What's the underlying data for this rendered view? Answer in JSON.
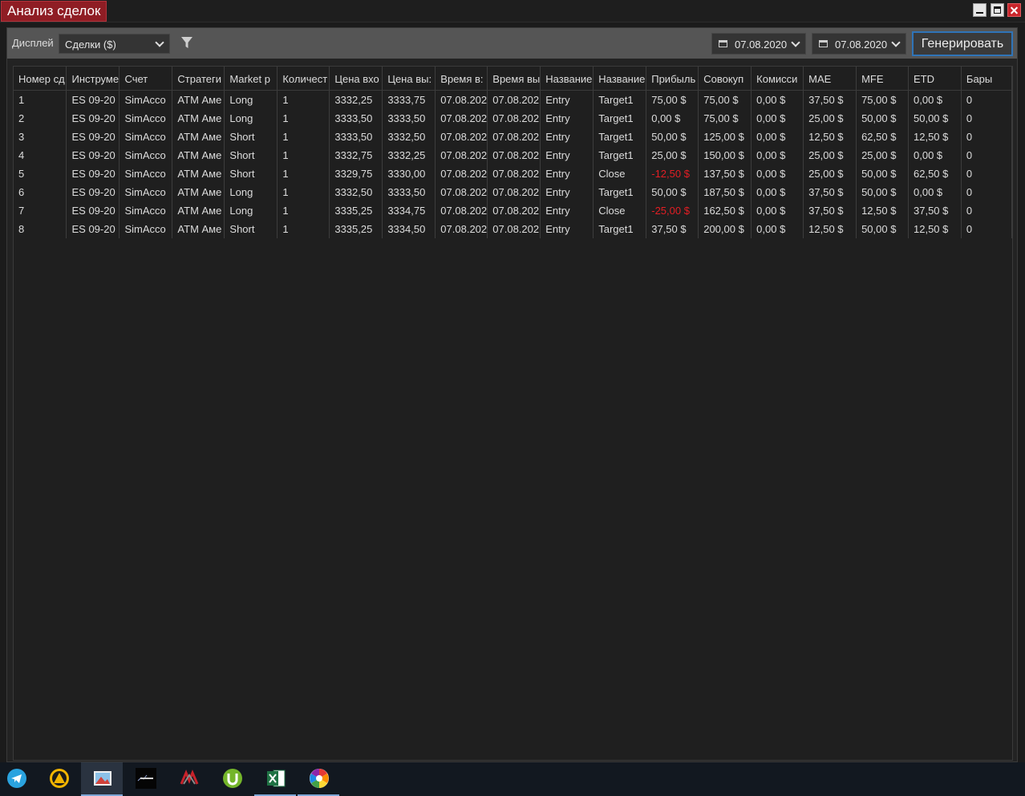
{
  "window": {
    "title": "Анализ сделок"
  },
  "toolbar": {
    "display_label": "Дисплей",
    "display_value": "Сделки ($)",
    "date_from": "07.08.2020",
    "date_to": "07.08.2020",
    "generate_label": "Генерировать"
  },
  "table": {
    "columns": [
      "Номер сд",
      "Инструме",
      "Счет",
      "Стратеги",
      "Market p",
      "Количест",
      "Цена вхо",
      "Цена вы:",
      "Время в:",
      "Время вы",
      "Название",
      "Название",
      "Прибыль",
      "Совокуп",
      "Комисси",
      "MAE",
      "MFE",
      "ETD",
      "Бары"
    ],
    "rows": [
      [
        "1",
        "ES 09-20",
        "SimAcco",
        "ATM Аме",
        "Long",
        "1",
        "3332,25",
        "3333,75",
        "07.08.202",
        "07.08.202",
        "Entry",
        "Target1",
        "75,00 $",
        "75,00 $",
        "0,00 $",
        "37,50 $",
        "75,00 $",
        "0,00 $",
        "0"
      ],
      [
        "2",
        "ES 09-20",
        "SimAcco",
        "ATM Аме",
        "Long",
        "1",
        "3333,50",
        "3333,50",
        "07.08.202",
        "07.08.202",
        "Entry",
        "Target1",
        "0,00 $",
        "75,00 $",
        "0,00 $",
        "25,00 $",
        "50,00 $",
        "50,00 $",
        "0"
      ],
      [
        "3",
        "ES 09-20",
        "SimAcco",
        "ATM Аме",
        "Short",
        "1",
        "3333,50",
        "3332,50",
        "07.08.202",
        "07.08.202",
        "Entry",
        "Target1",
        "50,00 $",
        "125,00 $",
        "0,00 $",
        "12,50 $",
        "62,50 $",
        "12,50 $",
        "0"
      ],
      [
        "4",
        "ES 09-20",
        "SimAcco",
        "ATM Аме",
        "Short",
        "1",
        "3332,75",
        "3332,25",
        "07.08.202",
        "07.08.202",
        "Entry",
        "Target1",
        "25,00 $",
        "150,00 $",
        "0,00 $",
        "25,00 $",
        "25,00 $",
        "0,00 $",
        "0"
      ],
      [
        "5",
        "ES 09-20",
        "SimAcco",
        "ATM Аме",
        "Short",
        "1",
        "3329,75",
        "3330,00",
        "07.08.202",
        "07.08.202",
        "Entry",
        "Close",
        "-12,50 $",
        "137,50 $",
        "0,00 $",
        "25,00 $",
        "50,00 $",
        "62,50 $",
        "0"
      ],
      [
        "6",
        "ES 09-20",
        "SimAcco",
        "ATM Аме",
        "Long",
        "1",
        "3332,50",
        "3333,50",
        "07.08.202",
        "07.08.202",
        "Entry",
        "Target1",
        "50,00 $",
        "187,50 $",
        "0,00 $",
        "37,50 $",
        "50,00 $",
        "0,00 $",
        "0"
      ],
      [
        "7",
        "ES 09-20",
        "SimAcco",
        "ATM Аме",
        "Long",
        "1",
        "3335,25",
        "3334,75",
        "07.08.202",
        "07.08.202",
        "Entry",
        "Close",
        "-25,00 $",
        "162,50 $",
        "0,00 $",
        "37,50 $",
        "12,50 $",
        "37,50 $",
        "0"
      ],
      [
        "8",
        "ES 09-20",
        "SimAcco",
        "ATM Аме",
        "Short",
        "1",
        "3335,25",
        "3334,50",
        "07.08.202",
        "07.08.202",
        "Entry",
        "Target1",
        "37,50 $",
        "200,00 $",
        "0,00 $",
        "12,50 $",
        "50,00 $",
        "12,50 $",
        "0"
      ]
    ]
  },
  "colors": {
    "negative": "#e31e24",
    "title_bg": "#8f1d24",
    "accent": "#2f74b8"
  },
  "taskbar": {
    "apps": [
      {
        "icon": "telegram-icon"
      },
      {
        "icon": "warning-app-icon"
      },
      {
        "icon": "image-viewer-icon",
        "active": true
      },
      {
        "icon": "markets-app-icon",
        "caption": "Markets"
      },
      {
        "icon": "ninja-trader-icon"
      },
      {
        "icon": "utorrent-icon"
      },
      {
        "icon": "excel-icon"
      },
      {
        "icon": "picasa-icon"
      }
    ]
  }
}
